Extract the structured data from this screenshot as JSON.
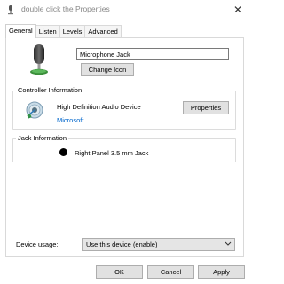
{
  "window": {
    "title": "double click the  Properties",
    "close_glyph": "✕"
  },
  "tabs": [
    {
      "label": "General",
      "active": true
    },
    {
      "label": "Listen",
      "active": false
    },
    {
      "label": "Levels",
      "active": false
    },
    {
      "label": "Advanced",
      "active": false
    }
  ],
  "general": {
    "device_name_value": "Microphone Jack",
    "change_icon_label": "Change Icon",
    "device_icon": "microphone-icon"
  },
  "controller": {
    "group_label": "Controller Information",
    "device": "High Definition Audio Device",
    "manufacturer": "Microsoft",
    "properties_label": "Properties",
    "icon": "speaker-icon"
  },
  "jack": {
    "group_label": "Jack Information",
    "description": "Right Panel 3.5 mm Jack",
    "color": "#000000"
  },
  "usage": {
    "label": "Device usage:",
    "selected": "Use this device (enable)"
  },
  "footer": {
    "ok_label": "OK",
    "cancel_label": "Cancel",
    "apply_label": "Apply"
  }
}
